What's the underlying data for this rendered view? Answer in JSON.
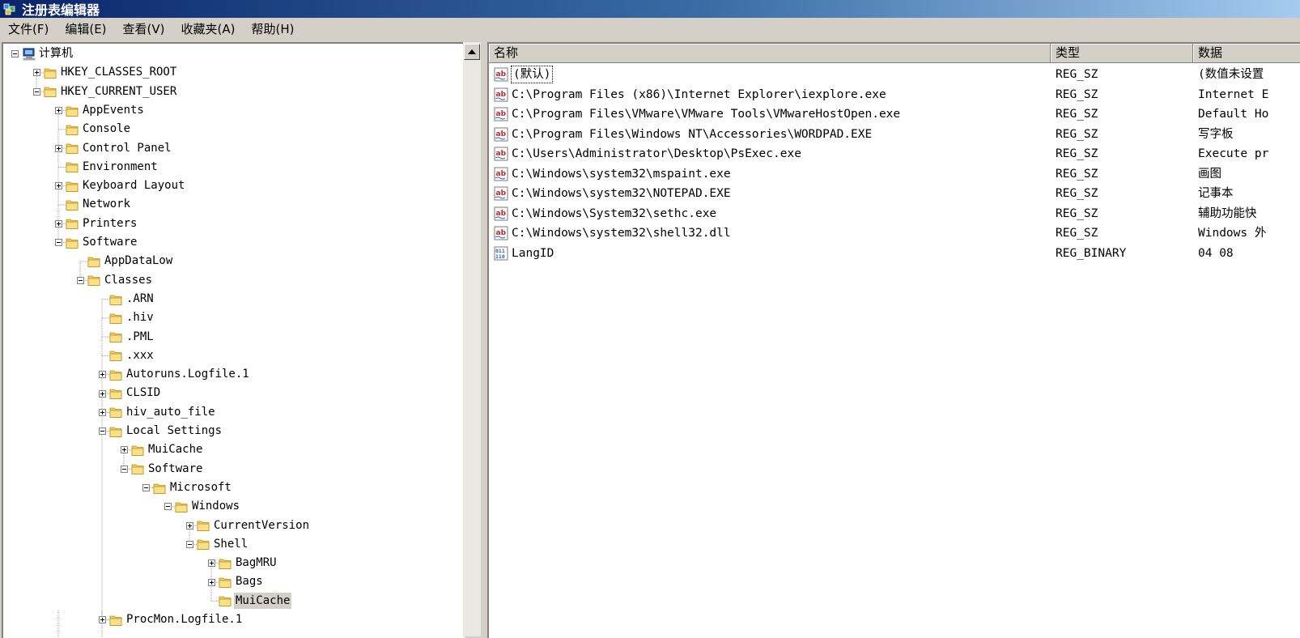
{
  "window": {
    "title": "注册表编辑器"
  },
  "menu": [
    "文件(F)",
    "编辑(E)",
    "查看(V)",
    "收藏夹(A)",
    "帮助(H)"
  ],
  "tree": [
    {
      "label": "计算机",
      "depth": 0,
      "expander": "minus",
      "icon": "computer-icon"
    },
    {
      "label": "HKEY_CLASSES_ROOT",
      "depth": 1,
      "expander": "plus",
      "icon": "folder-icon"
    },
    {
      "label": "HKEY_CURRENT_USER",
      "depth": 1,
      "expander": "minus",
      "icon": "folder-icon"
    },
    {
      "label": "AppEvents",
      "depth": 2,
      "expander": "plus",
      "icon": "folder-icon"
    },
    {
      "label": "Console",
      "depth": 2,
      "expander": "none",
      "icon": "folder-icon"
    },
    {
      "label": "Control Panel",
      "depth": 2,
      "expander": "plus",
      "icon": "folder-icon"
    },
    {
      "label": "Environment",
      "depth": 2,
      "expander": "none",
      "icon": "folder-icon"
    },
    {
      "label": "Keyboard Layout",
      "depth": 2,
      "expander": "plus",
      "icon": "folder-icon"
    },
    {
      "label": "Network",
      "depth": 2,
      "expander": "none",
      "icon": "folder-icon"
    },
    {
      "label": "Printers",
      "depth": 2,
      "expander": "plus",
      "icon": "folder-icon"
    },
    {
      "label": "Software",
      "depth": 2,
      "expander": "minus",
      "icon": "folder-icon"
    },
    {
      "label": "AppDataLow",
      "depth": 3,
      "expander": "none",
      "icon": "folder-icon"
    },
    {
      "label": "Classes",
      "depth": 3,
      "expander": "minus",
      "icon": "folder-icon"
    },
    {
      "label": ".ARN",
      "depth": 4,
      "expander": "none",
      "icon": "folder-icon"
    },
    {
      "label": ".hiv",
      "depth": 4,
      "expander": "none",
      "icon": "folder-icon"
    },
    {
      "label": ".PML",
      "depth": 4,
      "expander": "none",
      "icon": "folder-icon"
    },
    {
      "label": ".xxx",
      "depth": 4,
      "expander": "none",
      "icon": "folder-icon"
    },
    {
      "label": "Autoruns.Logfile.1",
      "depth": 4,
      "expander": "plus",
      "icon": "folder-icon"
    },
    {
      "label": "CLSID",
      "depth": 4,
      "expander": "plus",
      "icon": "folder-icon"
    },
    {
      "label": "hiv_auto_file",
      "depth": 4,
      "expander": "plus",
      "icon": "folder-icon"
    },
    {
      "label": "Local Settings",
      "depth": 4,
      "expander": "minus",
      "icon": "folder-icon"
    },
    {
      "label": "MuiCache",
      "depth": 5,
      "expander": "plus",
      "icon": "folder-icon"
    },
    {
      "label": "Software",
      "depth": 5,
      "expander": "minus",
      "icon": "folder-icon"
    },
    {
      "label": "Microsoft",
      "depth": 6,
      "expander": "minus",
      "icon": "folder-icon"
    },
    {
      "label": "Windows",
      "depth": 7,
      "expander": "minus",
      "icon": "folder-icon"
    },
    {
      "label": "CurrentVersion",
      "depth": 8,
      "expander": "plus",
      "icon": "folder-icon"
    },
    {
      "label": "Shell",
      "depth": 8,
      "expander": "minus",
      "icon": "folder-icon"
    },
    {
      "label": "BagMRU",
      "depth": 9,
      "expander": "plus",
      "icon": "folder-icon"
    },
    {
      "label": "Bags",
      "depth": 9,
      "expander": "plus",
      "icon": "folder-icon"
    },
    {
      "label": "MuiCache",
      "depth": 9,
      "expander": "none",
      "icon": "folder-icon",
      "selected": true
    },
    {
      "label": "ProcMon.Logfile.1",
      "depth": 4,
      "expander": "plus",
      "icon": "folder-icon"
    }
  ],
  "columns": [
    "名称",
    "类型",
    "数据"
  ],
  "values": [
    {
      "name": "(默认)",
      "type": "REG_SZ",
      "data": "(数值未设置",
      "icon": "string-value-icon",
      "focused": true
    },
    {
      "name": "C:\\Program Files (x86)\\Internet Explorer\\iexplore.exe",
      "type": "REG_SZ",
      "data": "Internet E",
      "icon": "string-value-icon"
    },
    {
      "name": "C:\\Program Files\\VMware\\VMware Tools\\VMwareHostOpen.exe",
      "type": "REG_SZ",
      "data": "Default Ho",
      "icon": "string-value-icon"
    },
    {
      "name": "C:\\Program Files\\Windows NT\\Accessories\\WORDPAD.EXE",
      "type": "REG_SZ",
      "data": "写字板",
      "icon": "string-value-icon"
    },
    {
      "name": "C:\\Users\\Administrator\\Desktop\\PsExec.exe",
      "type": "REG_SZ",
      "data": "Execute pr",
      "icon": "string-value-icon"
    },
    {
      "name": "C:\\Windows\\system32\\mspaint.exe",
      "type": "REG_SZ",
      "data": "画图",
      "icon": "string-value-icon"
    },
    {
      "name": "C:\\Windows\\system32\\NOTEPAD.EXE",
      "type": "REG_SZ",
      "data": "记事本",
      "icon": "string-value-icon"
    },
    {
      "name": "C:\\Windows\\System32\\sethc.exe",
      "type": "REG_SZ",
      "data": "辅助功能快",
      "icon": "string-value-icon"
    },
    {
      "name": "C:\\Windows\\system32\\shell32.dll",
      "type": "REG_SZ",
      "data": "Windows 外",
      "icon": "string-value-icon"
    },
    {
      "name": "LangID",
      "type": "REG_BINARY",
      "data": "04 08",
      "icon": "binary-value-icon"
    }
  ]
}
